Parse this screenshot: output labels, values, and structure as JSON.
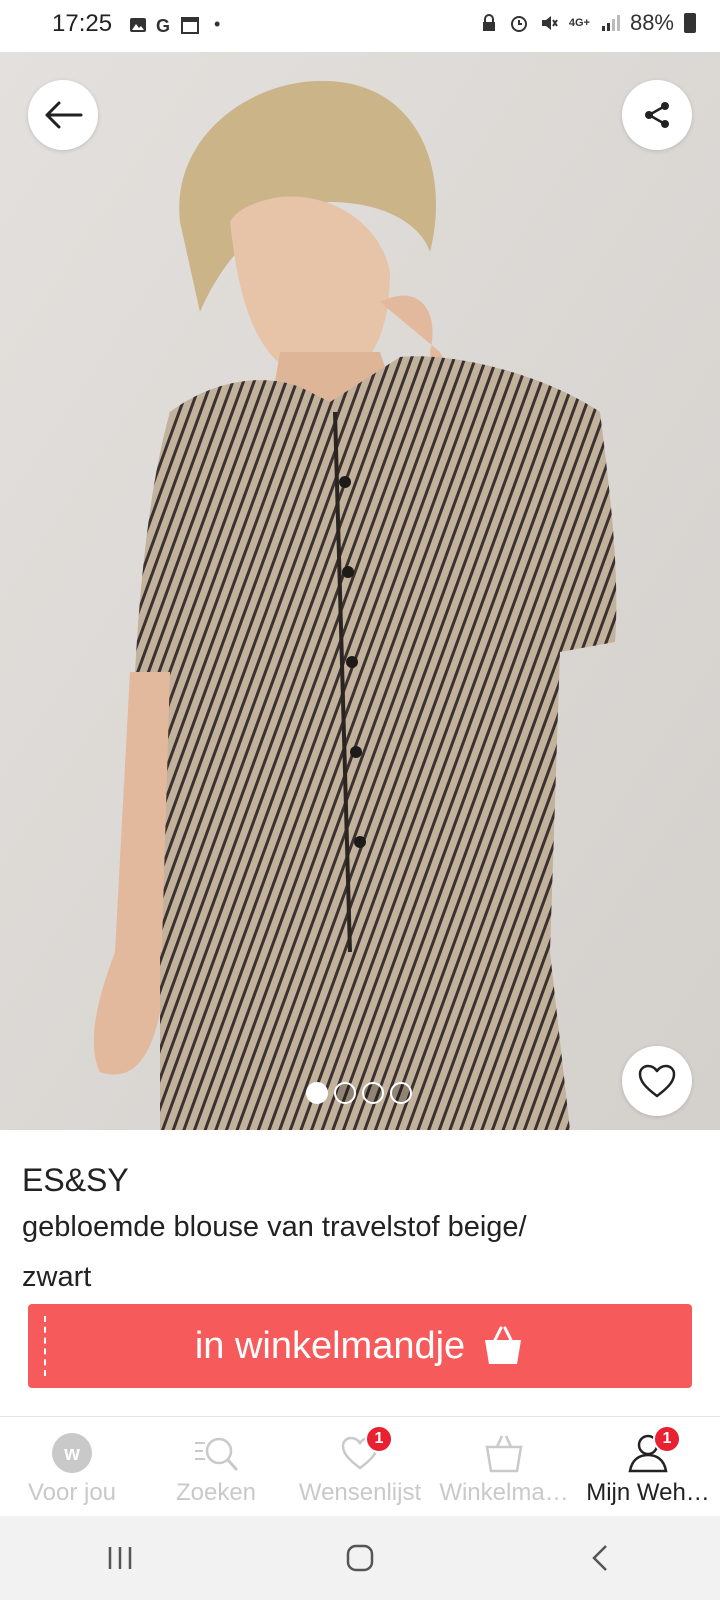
{
  "status_bar": {
    "time": "17:25",
    "battery": "88%",
    "network": "4G+"
  },
  "product_image": {
    "carousel_dots": 4,
    "active_dot": 0
  },
  "product": {
    "brand": "ES&SY",
    "name_line1": "gebloemde blouse van travelstof beige/",
    "name_line2": "zwart"
  },
  "cart_button": {
    "label": "in winkelmandje"
  },
  "bottom_nav": {
    "items": [
      {
        "label": "Voor jou",
        "icon": "wehkamp-logo-icon"
      },
      {
        "label": "Zoeken",
        "icon": "search-icon"
      },
      {
        "label": "Wensenlijst",
        "icon": "heart-icon",
        "badge": "1"
      },
      {
        "label": "Winkelma…",
        "icon": "shopping-bag-icon"
      },
      {
        "label": "Mijn Weh…",
        "icon": "user-icon",
        "badge": "1"
      }
    ]
  },
  "colors": {
    "accent": "#f65a5b",
    "badge": "#e8202f"
  }
}
